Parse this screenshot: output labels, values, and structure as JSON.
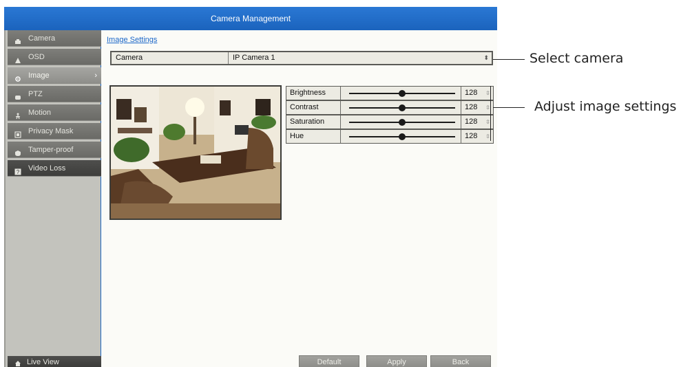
{
  "window": {
    "title": "Camera Management"
  },
  "sidebar": {
    "items": [
      {
        "label": "Camera",
        "icon": "camera-icon",
        "state": "normal"
      },
      {
        "label": "OSD",
        "icon": "osd-icon",
        "state": "normal"
      },
      {
        "label": "Image",
        "icon": "image-icon",
        "state": "active"
      },
      {
        "label": "PTZ",
        "icon": "ptz-icon",
        "state": "normal"
      },
      {
        "label": "Motion",
        "icon": "motion-icon",
        "state": "normal"
      },
      {
        "label": "Privacy Mask",
        "icon": "privacy-mask-icon",
        "state": "normal"
      },
      {
        "label": "Tamper-proof",
        "icon": "tamper-proof-icon",
        "state": "normal"
      },
      {
        "label": "Video Loss",
        "icon": "video-loss-icon",
        "state": "dark"
      }
    ],
    "live_view": "Live View",
    "active_arrow": "›"
  },
  "main": {
    "section_title": "Image Settings",
    "camera": {
      "label": "Camera",
      "value": "IP Camera 1"
    },
    "adjustments": [
      {
        "label": "Brightness",
        "value": "128",
        "level": 0.5
      },
      {
        "label": "Contrast",
        "value": "128",
        "level": 0.5
      },
      {
        "label": "Saturation",
        "value": "128",
        "level": 0.5
      },
      {
        "label": "Hue",
        "value": "128",
        "level": 0.5
      }
    ],
    "buttons": {
      "default": "Default",
      "apply": "Apply",
      "back": "Back"
    }
  },
  "callouts": {
    "select_camera": "Select camera",
    "adjust_image": "Adjust image settings"
  },
  "colors": {
    "titlebar": "#1f67c2",
    "link": "#1a66c8"
  }
}
